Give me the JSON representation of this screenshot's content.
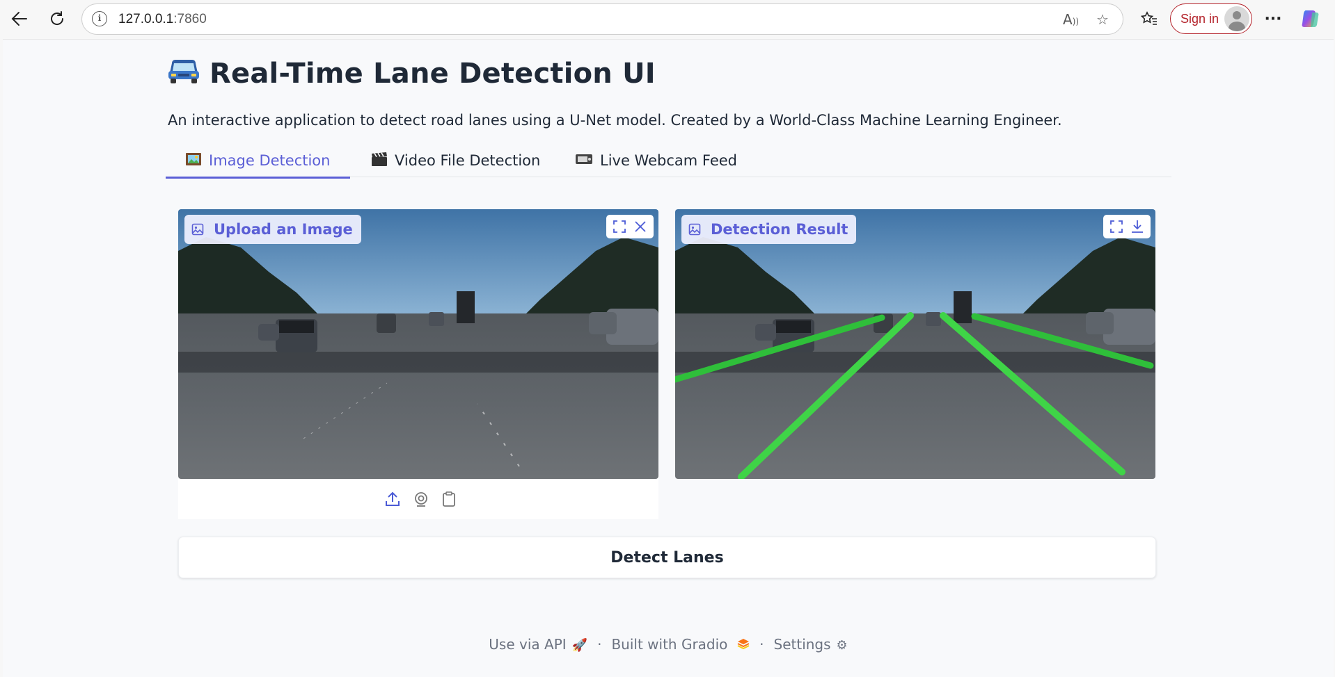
{
  "browser": {
    "url_host": "127.0.0.1",
    "url_port": ":7860",
    "signin_label": "Sign in"
  },
  "app": {
    "title": "Real-Time Lane Detection UI",
    "title_icon": "car-emoji",
    "subtitle": "An interactive application to detect road lanes using a U-Net model. Created by a World-Class Machine Learning Engineer."
  },
  "tabs": [
    {
      "label": "Image Detection",
      "icon": "picture-frame-emoji",
      "active": true
    },
    {
      "label": "Video File Detection",
      "icon": "clapper-board-emoji",
      "active": false
    },
    {
      "label": "Live Webcam Feed",
      "icon": "video-camera-emoji",
      "active": false
    }
  ],
  "input_panel": {
    "label": "Upload an Image",
    "controls": [
      "fullscreen-icon",
      "close-icon"
    ],
    "source_icons": [
      "upload-icon",
      "webcam-icon",
      "clipboard-icon"
    ]
  },
  "output_panel": {
    "label": "Detection Result",
    "controls": [
      "fullscreen-icon",
      "download-icon"
    ]
  },
  "action": {
    "detect_label": "Detect Lanes"
  },
  "footer": {
    "api": "Use via API",
    "built": "Built with Gradio",
    "settings": "Settings",
    "separator": "·"
  },
  "colors": {
    "accent": "#5b5fd6",
    "lane_green": "#3fd447",
    "signin_red": "#b4232b"
  }
}
